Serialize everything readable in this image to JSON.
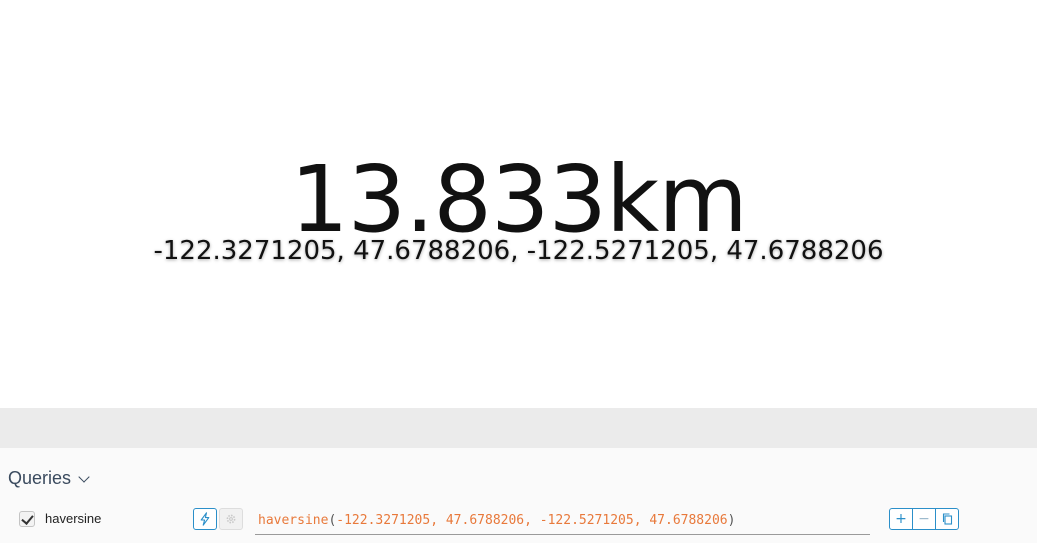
{
  "display": {
    "value": "13.833km",
    "subtitle": "-122.3271205, 47.6788206, -122.5271205, 47.6788206"
  },
  "queries": {
    "header_label": "Queries",
    "items": [
      {
        "checked": true,
        "name": "haversine",
        "expression": {
          "function": "haversine",
          "open": "(",
          "args": "-122.3271205, 47.6788206, -122.5271205, 47.6788206",
          "close": ")"
        },
        "icons": [
          "bolt-icon",
          "gear-icon"
        ],
        "controls": [
          "+",
          "−",
          "copy-icon"
        ]
      }
    ]
  },
  "colors": {
    "accent": "#2b8fc9",
    "query_text": "#e8793b",
    "band": "#ebebeb"
  }
}
